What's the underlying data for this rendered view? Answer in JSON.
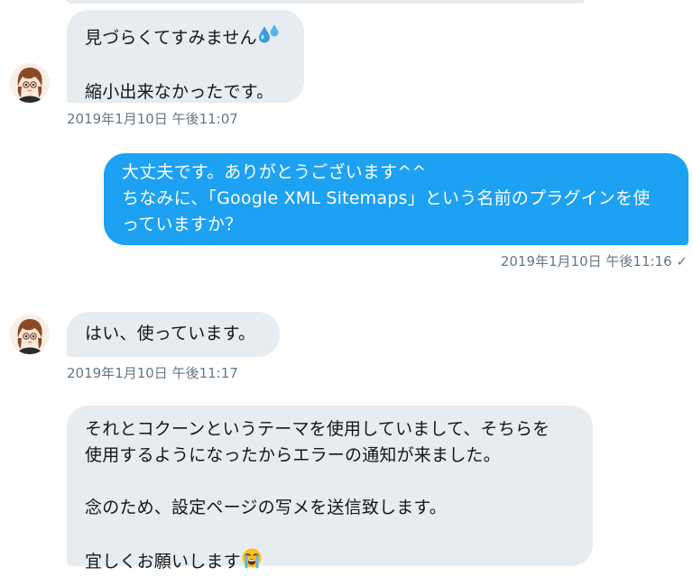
{
  "conversation": {
    "messages": [
      {
        "direction": "incoming",
        "lines": [
          "見づらくてすみません",
          "",
          "縮小出来なかったです。"
        ],
        "emoji": "sweat-droplets-icon",
        "timestamp": "2019年1月10日 午後11:07"
      },
      {
        "direction": "outgoing",
        "lines": [
          "大丈夫です。ありがとうございます^^",
          "ちなみに、「Google XML Sitemaps」という名前のプラグインを使",
          "っていますか？"
        ],
        "timestamp": "2019年1月10日 午後11:16",
        "read_mark": "✓"
      },
      {
        "direction": "incoming",
        "lines": [
          "はい、使っています。"
        ],
        "timestamp": "2019年1月10日 午後11:17"
      },
      {
        "direction": "incoming",
        "lines": [
          "それとコクーンというテーマを使用していまして、そちらを",
          "使用するようになったからエラーの通知が来ました。",
          "",
          "念のため、設定ページの写メを送信致します。",
          "",
          "宜しくお願いします"
        ],
        "emoji": "loudly-crying-face-icon"
      }
    ]
  },
  "colors": {
    "incoming_bubble": "#e6ecf0",
    "outgoing_bubble": "#1da1f2",
    "timestamp_text": "#657786"
  }
}
